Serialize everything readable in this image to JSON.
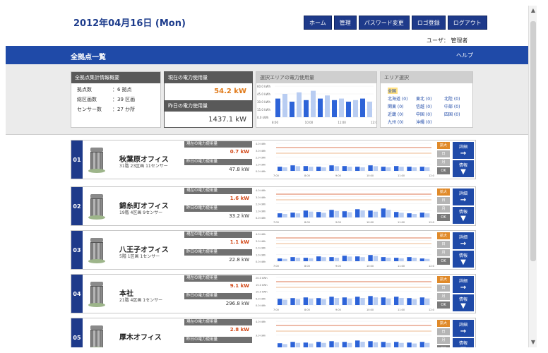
{
  "header": {
    "date": "2012年04月16日 (Mon)",
    "nav": [
      "ホーム",
      "管理",
      "パスワード変更",
      "ロゴ登録",
      "ログアウト"
    ],
    "user": "ユーザ： 管理者"
  },
  "titlebar": {
    "title": "全拠点一覧",
    "help": "ヘルプ"
  },
  "summary": {
    "stats_title": "全拠点集計情報概要",
    "stats": [
      {
        "label": "拠点数",
        "value": "：6  拠点"
      },
      {
        "label": "総区画数",
        "value": "：39  区画"
      },
      {
        "label": "センサー数",
        "value": "：27  か所"
      }
    ],
    "current_title": "現在の電力使用量",
    "current_value": "54.2 kW",
    "prevday_title": "昨日の電力使用量",
    "prevday_value": "1437.1 kW",
    "area_chart_title": "選択エリアの電力使用量",
    "area_select_title": "エリア選択",
    "areas": [
      "全国",
      "北海道 (0)",
      "東北 (0)",
      "関東 (0)",
      "信越 (0)",
      "中部 (0)",
      "北陸 (0)",
      "近畿 (0)",
      "中国 (0)",
      "四国 (0)",
      "九州 (0)",
      "沖縄 (0)"
    ]
  },
  "metric_labels": {
    "current": "現在の電力使用量",
    "prev": "昨日の電力使用量"
  },
  "chart_x_ticks": [
    "7:00",
    "8:00",
    "9:00",
    "10:00",
    "11:00",
    "12:00"
  ],
  "controls": [
    "拡大",
    "日",
    "月",
    "OK"
  ],
  "actions": [
    {
      "label": "詳細",
      "icon": "→"
    },
    {
      "label": "情報",
      "icon": "▼"
    }
  ],
  "offices": [
    {
      "num": "01",
      "name": "秋葉原オフィス",
      "sub": "31階 23区画 11センサー",
      "current": "0.7 kW",
      "prev": "47.8 kW",
      "yticks": [
        "4.0 kWh",
        "3.0 kWh",
        "2.0 kWh",
        "1.0 kWh",
        "0.0 kWh"
      ],
      "bars": [
        0.3,
        0.4,
        0.35,
        0.3,
        0.4,
        0.35,
        0.3,
        0.4,
        0.3,
        0.35,
        0.3,
        0.3
      ],
      "colors": {
        "accent": "#d24a1a"
      }
    },
    {
      "num": "02",
      "name": "錦糸町オフィス",
      "sub": "19階 4区画 9センサー",
      "current": "1.6 kW",
      "prev": "33.2 kW",
      "yticks": [
        "4.0 kWh",
        "3.0 kWh",
        "2.0 kWh",
        "1.0 kWh",
        "0.0 kWh"
      ],
      "bars": [
        0.3,
        0.35,
        0.5,
        0.4,
        0.55,
        0.45,
        0.6,
        0.5,
        0.65,
        0.4,
        0.3,
        0.35
      ]
    },
    {
      "num": "03",
      "name": "八王子オフィス",
      "sub": "5階 1区画 1センサー",
      "current": "1.1 kW",
      "prev": "22.8 kW",
      "yticks": [
        "4.0 kWh",
        "3.0 kWh",
        "2.0 kWh",
        "1.0 kWh",
        "0.0 kWh"
      ],
      "bars": [
        0.2,
        0.3,
        0.25,
        0.35,
        0.3,
        0.4,
        0.35,
        0.45,
        0.3,
        0.25,
        0.3,
        0.2
      ]
    },
    {
      "num": "04",
      "name": "本社",
      "sub": "21階 4区画 1センサー",
      "current": "9.1 kW",
      "prev": "296.8 kW",
      "yticks": [
        "20.0 kWh",
        "15.0 kWh",
        "10.0 kWh",
        "5.0 kWh",
        "0.0 kWh"
      ],
      "bars": [
        0.45,
        0.5,
        0.55,
        0.5,
        0.6,
        0.55,
        0.6,
        0.65,
        0.55,
        0.6,
        0.5,
        0.55
      ]
    },
    {
      "num": "05",
      "name": "厚木オフィス",
      "sub": "",
      "current": "2.8 kW",
      "prev": "",
      "yticks": [
        "4.0 kWh",
        "3.0 kWh",
        "2.0 kWh"
      ],
      "bars": [
        0.4,
        0.5,
        0.45,
        0.5,
        0.55,
        0.5,
        0.6,
        0.55,
        0.5,
        0.5,
        0.45,
        0.5
      ]
    }
  ],
  "area_chart": {
    "yticks": [
      "60.0 kWh",
      "45.0 kWh",
      "30.0 kWh",
      "15.0 kWh",
      "0.0 kWh"
    ],
    "xticks": [
      "8:00",
      "10:00",
      "11:00",
      "12:00"
    ],
    "bars": [
      0.6,
      0.75,
      0.5,
      0.8,
      0.55,
      0.85,
      0.6,
      0.7,
      0.55,
      0.6,
      0.5,
      0.55,
      0.6,
      0.5
    ]
  }
}
